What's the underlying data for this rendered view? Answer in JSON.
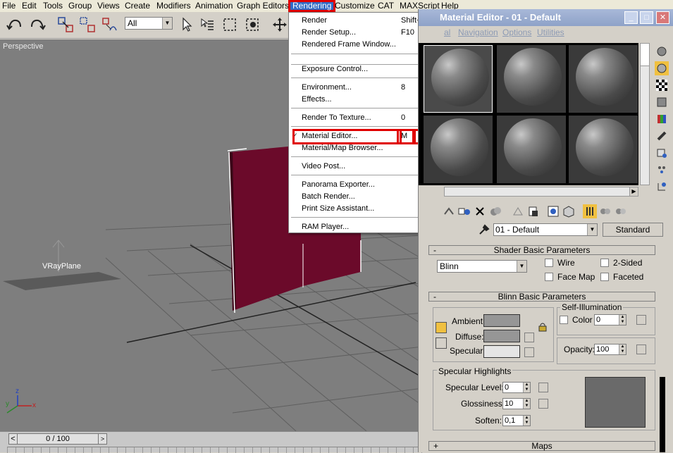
{
  "menubar": {
    "items": [
      {
        "label": "File"
      },
      {
        "label": "Edit"
      },
      {
        "label": "Tools"
      },
      {
        "label": "Group"
      },
      {
        "label": "Views"
      },
      {
        "label": "Create"
      },
      {
        "label": "Modifiers"
      },
      {
        "label": "Animation"
      },
      {
        "label": "Graph Editors"
      },
      {
        "label": "Rendering"
      },
      {
        "label": "Customize"
      },
      {
        "label": "CAT"
      },
      {
        "label": "MAXScript"
      },
      {
        "label": "Help"
      }
    ]
  },
  "toolbar": {
    "selection_filter": "All"
  },
  "viewport": {
    "label": "Perspective",
    "object_label": "VRayPlane",
    "axis_z": "z",
    "axis_y": "y",
    "axis_x": "x"
  },
  "timeline": {
    "frame": "0 / 100",
    "prev": "<",
    "next": ">"
  },
  "rendering_menu": {
    "items": [
      {
        "label": "Render",
        "key": "Shift+Q"
      },
      {
        "label": "Render Setup...",
        "key": "F10"
      },
      {
        "label": "Rendered Frame Window...",
        "key": ""
      },
      {
        "label": "Exposure Control...",
        "key": ""
      },
      {
        "label": "Environment...",
        "key": "8"
      },
      {
        "label": "Effects...",
        "key": ""
      },
      {
        "label": "Render To Texture...",
        "key": "0"
      },
      {
        "label": "Material Editor...",
        "key": "M"
      },
      {
        "label": "Material/Map Browser...",
        "key": ""
      },
      {
        "label": "Video Post...",
        "key": ""
      },
      {
        "label": "Panorama Exporter...",
        "key": ""
      },
      {
        "label": "Batch Render...",
        "key": ""
      },
      {
        "label": "Print Size Assistant...",
        "key": ""
      },
      {
        "label": "RAM Player...",
        "key": ""
      }
    ],
    "check_mark": "✓"
  },
  "material_editor": {
    "title": "Material Editor - 01 - Default",
    "menus": [
      {
        "label": "Material"
      },
      {
        "label": "Navigation"
      },
      {
        "label": "Options"
      },
      {
        "label": "Utilities"
      }
    ],
    "menu_first_visible": "al",
    "minimize": "_",
    "maximize": "□",
    "close": "✕",
    "material_name": "01 - Default",
    "material_type": "Standard",
    "shader_rollout": {
      "title": "Shader Basic Parameters",
      "toggle": "-",
      "shader": "Blinn",
      "wire": "Wire",
      "two_sided": "2-Sided",
      "face_map": "Face Map",
      "faceted": "Faceted"
    },
    "blinn_rollout": {
      "title": "Blinn Basic Parameters",
      "toggle": "-",
      "ambient": "Ambient:",
      "diffuse": "Diffuse:",
      "specular": "Specular:",
      "self_illum_group": "Self-Illumination",
      "color_label": "Color",
      "color_value": "0",
      "opacity_label": "Opacity:",
      "opacity_value": "100",
      "spec_group": "Specular Highlights",
      "spec_level_label": "Specular Level:",
      "spec_level_value": "0",
      "glossiness_label": "Glossiness:",
      "glossiness_value": "10",
      "soften_label": "Soften:",
      "soften_value": "0,1"
    },
    "maps_rollout": {
      "title": "Maps",
      "toggle": "+"
    }
  },
  "colors": {
    "highlight_red": "#e00000",
    "box_color": "#6b0a2a",
    "ambient_swatch": "#969696",
    "diffuse_swatch": "#969696",
    "specular_swatch": "#e5e5e5",
    "highlight_preview": "#6a6a6a"
  }
}
